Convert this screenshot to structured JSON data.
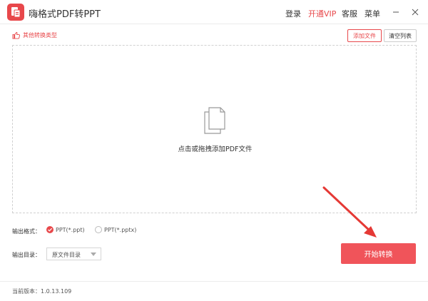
{
  "app": {
    "title": "嗨格式PDF转PPT",
    "accent_color": "#e8484b"
  },
  "nav": {
    "login": "登录",
    "vip": "开通VIP",
    "support": "客服",
    "menu": "菜单"
  },
  "window_controls": {
    "minimize_icon": "minimize-icon",
    "close_icon": "close-icon"
  },
  "toolbar": {
    "other_types": "其他转换类型",
    "add_file": "添加文件",
    "clear_list": "清空列表"
  },
  "dropzone": {
    "hint": "点击或拖拽添加PDF文件",
    "icon": "document-stack-icon"
  },
  "output_format": {
    "label": "输出格式：",
    "options": [
      {
        "label": "PPT(*.ppt)",
        "checked": true
      },
      {
        "label": "PPT(*.pptx)",
        "checked": false
      }
    ]
  },
  "output_dir": {
    "label": "输出目录：",
    "selected": "原文件目录"
  },
  "actions": {
    "start": "开始转换"
  },
  "footer": {
    "version": "当前版本：1.0.13.109"
  }
}
